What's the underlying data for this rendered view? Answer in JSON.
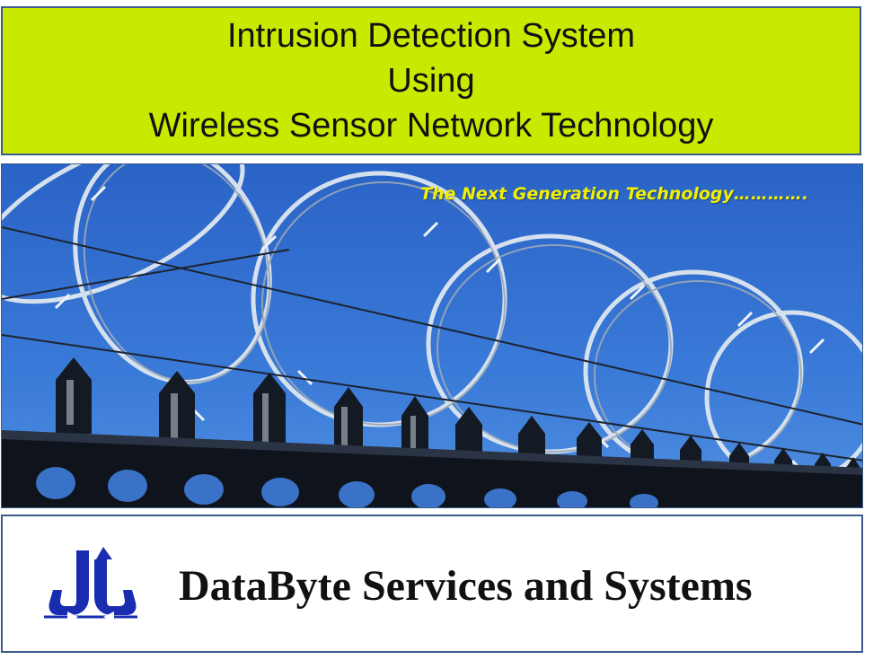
{
  "header": {
    "title_lines": [
      "Intrusion Detection System",
      "Using",
      "Wireless Sensor Network Technology"
    ],
    "background_color": "#c8ea00"
  },
  "banner": {
    "tagline": "The Next Generation Technology…………."
  },
  "footer": {
    "company_name": "DataByte Services and Systems",
    "logo_color": "#1a2db0"
  }
}
